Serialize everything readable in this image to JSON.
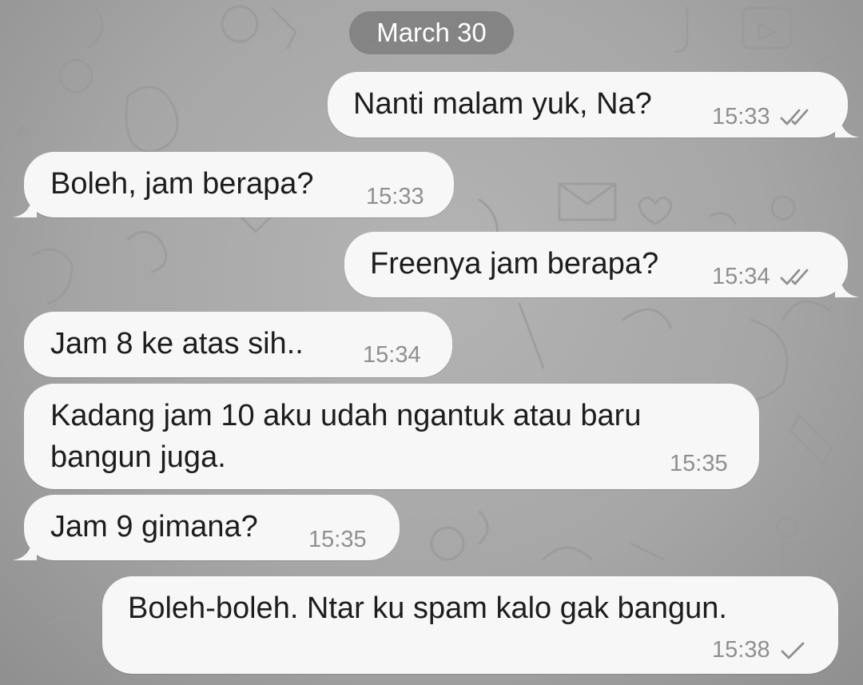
{
  "date_header": "March 30",
  "colors": {
    "bubble": "#f7f7f7",
    "text": "#1d1d1d",
    "meta": "#8f8f8f",
    "date_pill": "#6e6e6e",
    "background": "#a8a8a8"
  },
  "messages": [
    {
      "direction": "outgoing",
      "text": "Nanti malam yuk, Na?",
      "time": "15:33",
      "status_icon": "double-check-icon"
    },
    {
      "direction": "incoming",
      "text": "Boleh, jam berapa?",
      "time": "15:33"
    },
    {
      "direction": "outgoing",
      "text": "Freenya jam berapa?",
      "time": "15:34",
      "status_icon": "double-check-icon"
    },
    {
      "direction": "incoming",
      "text": "Jam 8 ke atas sih..",
      "time": "15:34"
    },
    {
      "direction": "incoming",
      "line1": "Kadang jam 10 aku udah ngantuk atau baru",
      "line2": "bangun juga.",
      "time": "15:35"
    },
    {
      "direction": "incoming",
      "text": "Jam 9 gimana?",
      "time": "15:35"
    },
    {
      "direction": "outgoing",
      "text": "Boleh-boleh. Ntar ku spam kalo gak bangun.",
      "time": "15:38",
      "status_icon": "single-check-icon"
    }
  ]
}
